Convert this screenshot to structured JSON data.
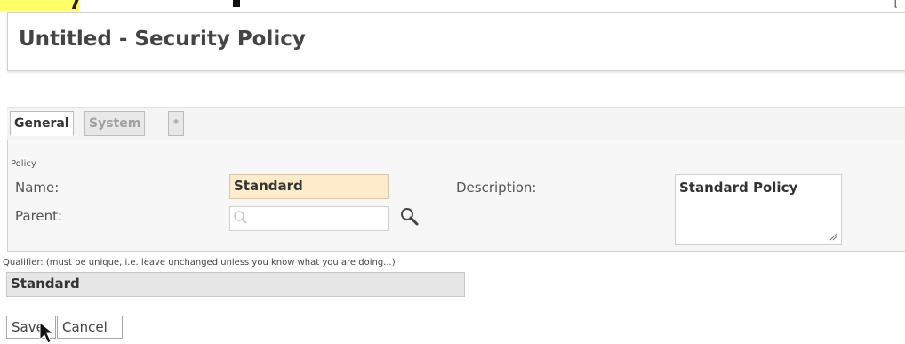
{
  "page": {
    "title": "Untitled - Security Policy"
  },
  "tabs": [
    {
      "label": "General",
      "active": true
    },
    {
      "label": "System",
      "active": false
    },
    {
      "label": "*",
      "active": false
    }
  ],
  "policy_section": {
    "label": "Policy",
    "name_label": "Name:",
    "name_value": "Standard",
    "parent_label": "Parent:",
    "parent_value": "",
    "description_label": "Description:",
    "description_value": "Standard Policy"
  },
  "qualifier": {
    "label": "Qualifier: (must be unique, i.e. leave unchanged unless you know what you are doing...)",
    "value": "Standard"
  },
  "actions": {
    "save_label": "Save",
    "cancel_label": "Cancel"
  },
  "colors": {
    "required_field_bg": "#fdebc9",
    "readonly_field_bg": "#e6e6e6"
  },
  "icons": {
    "parent_search": "search-icon",
    "placeholder": "magnifier-placeholder-icon"
  }
}
